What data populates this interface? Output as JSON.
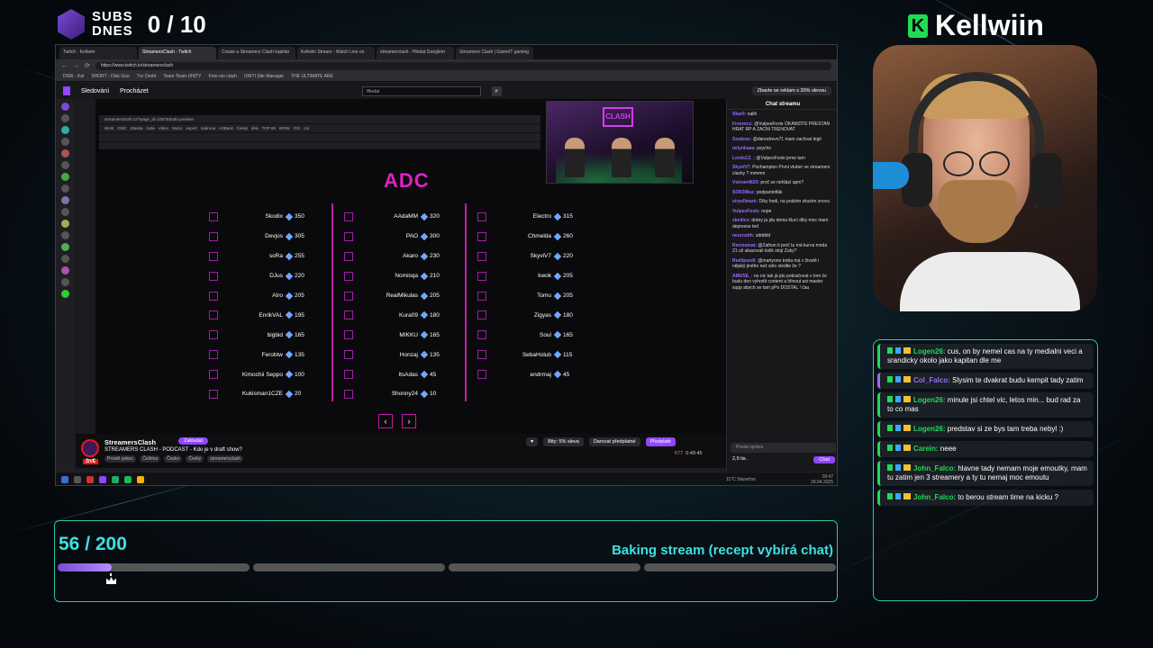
{
  "overlay": {
    "subs_label_1": "SUBS",
    "subs_label_2": "DNES",
    "subs_count": "0 / 10",
    "brand_name": "Kellwiin",
    "goal_count": "56 / 200",
    "goal_progress": 0.28,
    "goal_title": "Baking stream (recept vybírá chat)"
  },
  "browser": {
    "tabs": [
      "Twitch - Kellwiin",
      "StreamersClash - Twitch",
      "Create a Streamers Clash kapitán",
      "Kellwiin Stream - Watch Live on",
      "streamerclash - Hledat Googlem",
      "Streamers Clash | GameIT gaming"
    ],
    "url": "https://www.twitch.tv/streamersclash",
    "bookmarks": [
      "DISK - Kel",
      "SHORT - Disk Goo",
      "Tvc Drobt",
      "Team Team UNITY",
      "Free elo clash",
      "UNITI Site Manager",
      "THE ULTIMATE ARE"
    ]
  },
  "twitch": {
    "nav_following": "Sledování",
    "nav_browse": "Procházet",
    "search_placeholder": "Hledat",
    "promo": "Zbavte se reklam s 30% slevou"
  },
  "draft": {
    "title": "ADC",
    "inner_url": "streamersclash.cz/?page_id=2387&draft=preview",
    "inner_bookmarks": [
      "Work",
      "GMC",
      "Stavba",
      "Indie",
      "Video",
      "Music",
      "esport",
      "nadrona",
      "ArtBank",
      "Český",
      "disk",
      "TOP 69",
      "WOW",
      "IOS",
      "car"
    ],
    "columns": [
      [
        {
          "name": "Skodix",
          "price": "350"
        },
        {
          "name": "Devjos",
          "price": "305"
        },
        {
          "name": "soRa",
          "price": "255"
        },
        {
          "name": "DJus",
          "price": "220"
        },
        {
          "name": "Atro",
          "price": "205"
        },
        {
          "name": "EnrikVAL",
          "price": "195"
        },
        {
          "name": "bigbid",
          "price": "165"
        },
        {
          "name": "Ferobtw",
          "price": "135"
        },
        {
          "name": "Kimochii Seppo",
          "price": "100"
        },
        {
          "name": "Kukisman1CZE",
          "price": "20"
        }
      ],
      [
        {
          "name": "AAdaMM",
          "price": "320"
        },
        {
          "name": "PAO",
          "price": "300"
        },
        {
          "name": "Akaro",
          "price": "230"
        },
        {
          "name": "Nomisqa",
          "price": "210"
        },
        {
          "name": "RealMikulas",
          "price": "205"
        },
        {
          "name": "Kura09",
          "price": "180"
        },
        {
          "name": "MIKKU",
          "price": "165"
        },
        {
          "name": "Honzaj",
          "price": "135"
        },
        {
          "name": "ItsAdas",
          "price": "45"
        },
        {
          "name": "Shonny24",
          "price": "10"
        }
      ],
      [
        {
          "name": "Electro",
          "price": "315"
        },
        {
          "name": "Chmelda",
          "price": "260"
        },
        {
          "name": "SkyviV7",
          "price": "220"
        },
        {
          "name": "kwok",
          "price": "205"
        },
        {
          "name": "Tomu",
          "price": "205"
        },
        {
          "name": "Zigyas",
          "price": "180"
        },
        {
          "name": "Soul",
          "price": "165"
        },
        {
          "name": "SebaHolub",
          "price": "115"
        },
        {
          "name": "endrmaj",
          "price": "45"
        }
      ]
    ]
  },
  "stream": {
    "channel": "StreamersClash",
    "follow": "Zakladat",
    "title": "STREAMERS CLASH - PODCAST - Kdo je v draft show?",
    "tags": [
      "Prostě pokec",
      "Čeština",
      "Česko",
      "Český",
      "streamersclash"
    ],
    "live": "ŽIVĚ",
    "bits": "Bity: 5% sleva",
    "gift": "Darovat předplatné",
    "subscribe": "Předplatit",
    "viewers": "677",
    "uptime": "0:49:45"
  },
  "twitch_chat": {
    "header": "Chat streamu",
    "messages": [
      {
        "user": "Skar0:",
        "text": "nalih"
      },
      {
        "user": "Freezecz:",
        "text": "@VulpesFoxie OKAMZITE PRESTAN HRAT RP A ZACNI TRENOVAT"
      },
      {
        "user": "Soukrax:",
        "text": "@danodrevo71 mam zachvat legit"
      },
      {
        "user": "nelynkaaa:",
        "text": "psycho"
      },
      {
        "user": "LordsCZ_:",
        "text": "@VulpesFoxie jeme tam"
      },
      {
        "user": "SkyviV7:",
        "text": "Pochampion Prvni vtuber ve streamers clashy ? mmmm"
      },
      {
        "user": "Vstrom4620:",
        "text": "proč se nehlásí apm?"
      },
      {
        "user": "SOR3Wuz:",
        "text": "podpantoflák"
      },
      {
        "user": "stryellmani:",
        "text": "Díky hodi, na podzim zkusím znovu"
      },
      {
        "user": "VulpesFoxie:",
        "text": "nope"
      },
      {
        "user": "skedice:",
        "text": "dobry ja jdu domu klucí diky moc mam depresse ted"
      },
      {
        "user": "neurosbh:",
        "text": "sddddd"
      },
      {
        "user": "Renziomat:",
        "text": "@Zaihun ti proč tu má kurva moda 21 už ukazovali kolik stojí Zuky?"
      },
      {
        "user": "Redlipsedi:",
        "text": "@martyono treba má v životě i nějaký jiného než sólo sledite že ?"
      },
      {
        "user": "AMUSE_:",
        "text": "no nic tak já jdu pokračovat v tom že budu den vyhodit content a hlinout asi master supp abych se tam pPo DOSTAL ! čau"
      }
    ],
    "input_placeholder": "Poslat zprávu",
    "points": "2,9 tis.",
    "send": "Chat"
  },
  "taskbar": {
    "weather": "11°C Slunečno",
    "time": "18:47",
    "date": "29.04.2025"
  },
  "overlay_chat": [
    {
      "user": "Logen26:",
      "text": "cus, on by nemel cas na ty medialni veci a srandicky okolo jako kapitan dle me",
      "color": "#1fdb55"
    },
    {
      "user": "Col_Falco:",
      "text": "Slysim te dvakrat budu kempit tady zatim",
      "color": "#9b6bff"
    },
    {
      "user": "Logen26:",
      "text": "minule jsi chtel vic, letos min... bud rad za to co mas",
      "color": "#1fdb55"
    },
    {
      "user": "Logen26:",
      "text": "predstav si ze bys tam treba nebyl :)",
      "color": "#1fdb55"
    },
    {
      "user": "Carein:",
      "text": "neee",
      "color": "#1fdb55"
    },
    {
      "user": "John_Falco:",
      "text": "hlavne tady nemam moje emoutky, mam tu zatim jen 3 streamery a ty tu nemaj moc emoutu",
      "color": "#1fdb55"
    },
    {
      "user": "John_Falco:",
      "text": "to berou stream time na kicku ?",
      "color": "#1fdb55"
    }
  ]
}
